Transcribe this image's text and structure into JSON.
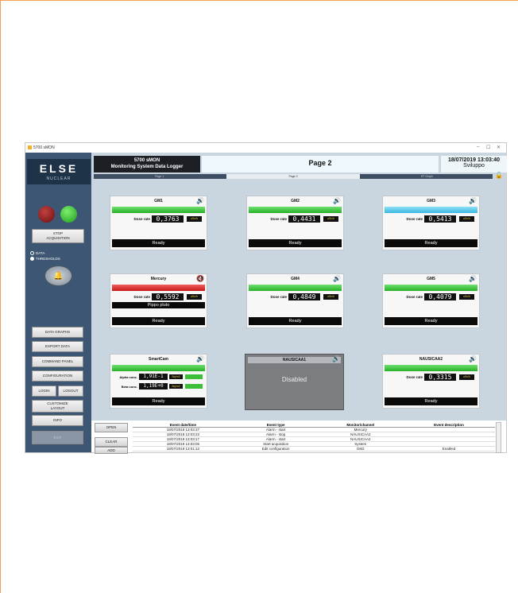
{
  "window": {
    "title": "5700 sMON",
    "controls": [
      "–",
      "☐",
      "✕"
    ]
  },
  "logo": {
    "brand": "ELSE",
    "sub": "NUCLEAR"
  },
  "header": {
    "app_line1": "5700 sMON",
    "app_line2": "Monitoring System Data Logger",
    "page_title": "Page 2",
    "datetime": "18/07/2019 13:03:40",
    "user": "Sviluppo"
  },
  "tabs": [
    "Page 1",
    "Page 2",
    "RT Graph"
  ],
  "sidebar": {
    "stop_label_1": "STOP",
    "stop_label_2": "ACQUISITION",
    "radio_data": "DATA",
    "radio_thresholds": "THRESHOLDS",
    "data_graphs": "DATA GRAPHS",
    "export_data": "EXPORT DATA",
    "command_panel": "COMMAND PANEL",
    "configuration": "CONFIGURATION",
    "login": "LOGIN",
    "logout": "LOGOUT",
    "customize_1": "CUSTOMIZE",
    "customize_2": "LAYOUT",
    "info": "INFO",
    "exit": "EXIT"
  },
  "devices": {
    "gm1": {
      "name": "GM1",
      "dose_label": "Dose rate",
      "value": "0,3763",
      "unit": "uSv/h",
      "status": "Ready"
    },
    "gm2": {
      "name": "GM2",
      "dose_label": "Dose rate",
      "value": "0,4431",
      "unit": "uSv/h",
      "status": "Ready"
    },
    "gm3": {
      "name": "GM3",
      "dose_label": "Dose rate",
      "value": "0,5413",
      "unit": "uSv/h",
      "status": "Ready"
    },
    "mercury": {
      "name": "Mercury",
      "dose_label": "Dose rate",
      "value": "0,5592",
      "unit": "uSv/h",
      "extra": "Pippo pluto",
      "status": "Ready"
    },
    "gm4": {
      "name": "GM4",
      "dose_label": "Dose rate",
      "value": "0,4849",
      "unit": "uSv/h",
      "status": "Ready"
    },
    "gm5": {
      "name": "GM5",
      "dose_label": "Dose rate",
      "value": "0,4079",
      "unit": "uSv/h",
      "status": "Ready"
    },
    "smartcam": {
      "name": "SmartCam",
      "alpha_label": "Alpha conc.",
      "alpha_value": "1,91E-1",
      "beta_label": "Beta conc.",
      "beta_value": "1,19E+0",
      "conc_unit": "Bq/m3",
      "status": "Ready"
    },
    "nausicaa1": {
      "name": "NAUSICAA1",
      "status": "Disabled"
    },
    "nausicaa2": {
      "name": "NAUSICAA2",
      "dose_label": "Dose rate",
      "value": "0,3315",
      "unit": "uSv/h",
      "status": "Ready"
    }
  },
  "events": {
    "buttons": {
      "open": "OPEN",
      "clear": "CLEAR",
      "add": "ADD"
    },
    "columns": [
      "Event date/time",
      "Event type",
      "Monitor/channel",
      "Event description"
    ],
    "rows": [
      [
        "18/07/2019 13:03:37",
        "Alarm - start",
        "Mercury",
        ""
      ],
      [
        "18/07/2019 13:03:22",
        "Alarm - stop",
        "NAUSICAA2",
        ""
      ],
      [
        "18/07/2019 13:03:17",
        "Alarm - start",
        "NAUSICAA2",
        ""
      ],
      [
        "18/07/2019 13:03:06",
        "Start acquisition",
        "System",
        ""
      ],
      [
        "18/07/2019 13:01:12",
        "Edit configuration",
        "GM2",
        "Enabled"
      ]
    ]
  },
  "colors": {
    "green": "#3cc03c",
    "cyan": "#4cc8ec",
    "red": "#e03030",
    "sidebar": "#3c5673",
    "panel": "#c9d6e0"
  }
}
